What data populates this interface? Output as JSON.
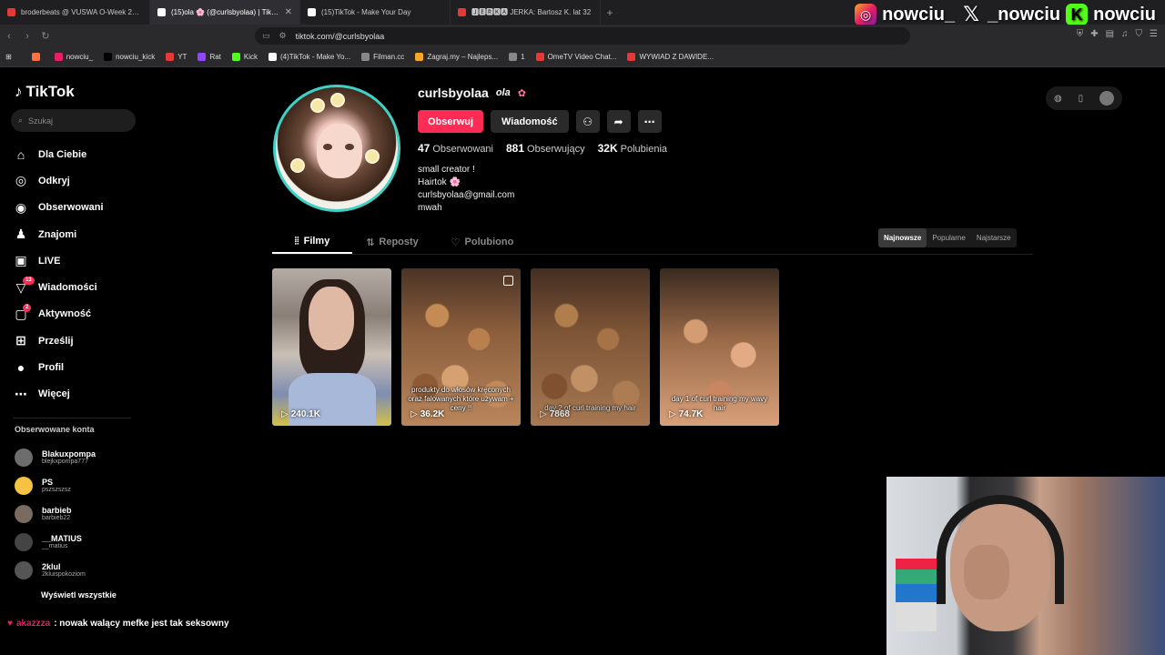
{
  "browser": {
    "tabs": [
      {
        "title": "broderbeats @ VUSWA O-Week 2024",
        "color": "#e53935",
        "active": false
      },
      {
        "title": "(15)ola 🌸 (@curlsbyolaa) | TikTok",
        "color": "#ffffff",
        "active": true
      },
      {
        "title": "(15)TikTok - Make Your Day",
        "color": "#ffffff",
        "active": false
      },
      {
        "title": "🅹🅴🆁🅺🅰 JERKA: Bartosz K. lat 32",
        "color": "#e53935",
        "active": false
      }
    ],
    "url": "tiktok.com/@curlsbyolaa",
    "bookmarks": [
      {
        "label": "",
        "color": "#ff7043"
      },
      {
        "label": "nowciu_",
        "color": "#e91e63"
      },
      {
        "label": "nowciu_kick",
        "color": "#000000"
      },
      {
        "label": "YT",
        "color": "#e53935"
      },
      {
        "label": "Rat",
        "color": "#9146ff"
      },
      {
        "label": "Kick",
        "color": "#53fc18"
      },
      {
        "label": "(4)TikTok - Make Yo...",
        "color": "#ffffff"
      },
      {
        "label": "Filman.cc",
        "color": "#888888"
      },
      {
        "label": "Zagraj.my – Najleps...",
        "color": "#f9a825"
      },
      {
        "label": "1",
        "color": "#888888"
      },
      {
        "label": "OmeTV Video Chat...",
        "color": "#e53935"
      },
      {
        "label": "WYWIAD Z DAWIDE...",
        "color": "#e53935"
      }
    ]
  },
  "overlay": {
    "instagram": "nowciu_",
    "x": "_nowciu",
    "kick": "nowciu",
    "chat_user": "akazzza",
    "chat_message": ": nowak walący mefke jest tak seksowny"
  },
  "sidebar": {
    "logo": "TikTok",
    "search_placeholder": "Szukaj",
    "items": [
      {
        "label": "Dla Ciebie",
        "icon": "home-icon",
        "glyph": "⌂"
      },
      {
        "label": "Odkryj",
        "icon": "compass-icon",
        "glyph": "◎"
      },
      {
        "label": "Obserwowani",
        "icon": "following-icon",
        "glyph": "◉"
      },
      {
        "label": "Znajomi",
        "icon": "friends-icon",
        "glyph": "♟"
      },
      {
        "label": "LIVE",
        "icon": "live-icon",
        "glyph": "▣"
      },
      {
        "label": "Wiadomości",
        "icon": "messages-icon",
        "glyph": "▽",
        "badge": "13"
      },
      {
        "label": "Aktywność",
        "icon": "activity-icon",
        "glyph": "▢",
        "badge": "2"
      },
      {
        "label": "Prześlij",
        "icon": "upload-icon",
        "glyph": "⊞"
      },
      {
        "label": "Profil",
        "icon": "profile-icon",
        "glyph": "●"
      },
      {
        "label": "Więcej",
        "icon": "more-icon",
        "glyph": "⋯"
      }
    ],
    "following_title": "Obserwowane konta",
    "following": [
      {
        "name": "Blakuxpompa",
        "handle": "blejkxpompa777"
      },
      {
        "name": "PS",
        "handle": "pszszszsz"
      },
      {
        "name": "barbieb",
        "handle": "barbieb22"
      },
      {
        "name": "__MATIUS",
        "handle": "__matius"
      },
      {
        "name": "2klul",
        "handle": "2kluispokoziom"
      }
    ],
    "see_all": "Wyświetl wszystkie"
  },
  "profile": {
    "username": "curlsbyolaa",
    "nickname": "ola",
    "follow_button": "Obserwuj",
    "message_button": "Wiadomość",
    "stats": [
      {
        "value": "47",
        "label": "Obserwowani"
      },
      {
        "value": "881",
        "label": "Obserwujący"
      },
      {
        "value": "32K",
        "label": "Polubienia"
      }
    ],
    "bio": [
      "small creator !",
      "Hairtok 🌸",
      "curlsbyolaa@gmail.com",
      "mwah"
    ]
  },
  "tabs": {
    "videos": "Filmy",
    "reposts": "Reposty",
    "liked": "Polubiono"
  },
  "sort": {
    "newest": "Najnowsze",
    "popular": "Popularne",
    "oldest": "Najstarsze"
  },
  "videos": [
    {
      "views": "240.1K",
      "caption": ""
    },
    {
      "views": "36.2K",
      "caption": "produkty do włosów kręconych oraz falowanych które używam + ceny !!"
    },
    {
      "views": "7868",
      "caption": "day 2 of curl training my hair"
    },
    {
      "views": "74.7K",
      "caption": "day 1 of curl training my wavy hair"
    }
  ]
}
